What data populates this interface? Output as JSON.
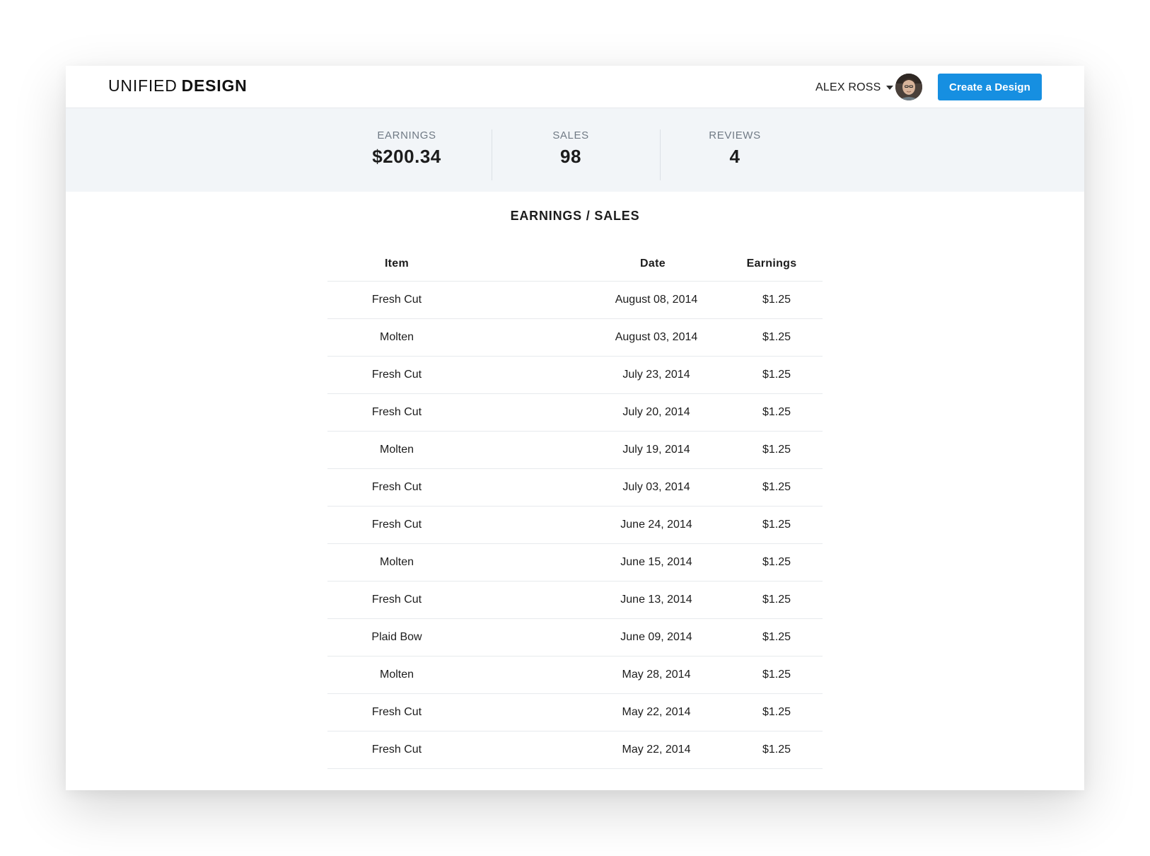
{
  "header": {
    "logo_light": "UNIFIED",
    "logo_bold": "DESIGN",
    "user_name": "ALEX ROSS",
    "create_button_label": "Create a Design"
  },
  "stats": [
    {
      "label": "EARNINGS",
      "value": "$200.34"
    },
    {
      "label": "SALES",
      "value": "98"
    },
    {
      "label": "REVIEWS",
      "value": "4"
    }
  ],
  "section_title": "EARNINGS / SALES",
  "table": {
    "columns": [
      "Item",
      "Date",
      "Earnings"
    ],
    "rows": [
      {
        "item": "Fresh Cut",
        "date": "August 08, 2014",
        "earnings": "$1.25"
      },
      {
        "item": "Molten",
        "date": "August 03, 2014",
        "earnings": "$1.25"
      },
      {
        "item": "Fresh Cut",
        "date": "July 23, 2014",
        "earnings": "$1.25"
      },
      {
        "item": "Fresh Cut",
        "date": "July 20, 2014",
        "earnings": "$1.25"
      },
      {
        "item": "Molten",
        "date": "July 19, 2014",
        "earnings": "$1.25"
      },
      {
        "item": "Fresh Cut",
        "date": "July 03, 2014",
        "earnings": "$1.25"
      },
      {
        "item": "Fresh Cut",
        "date": "June 24, 2014",
        "earnings": "$1.25"
      },
      {
        "item": "Molten",
        "date": "June 15, 2014",
        "earnings": "$1.25"
      },
      {
        "item": "Fresh Cut",
        "date": "June 13, 2014",
        "earnings": "$1.25"
      },
      {
        "item": "Plaid Bow",
        "date": "June 09, 2014",
        "earnings": "$1.25"
      },
      {
        "item": "Molten",
        "date": "May 28, 2014",
        "earnings": "$1.25"
      },
      {
        "item": "Fresh Cut",
        "date": "May 22, 2014",
        "earnings": "$1.25"
      },
      {
        "item": "Fresh Cut",
        "date": "May 22, 2014",
        "earnings": "$1.25"
      }
    ]
  },
  "colors": {
    "accent": "#168fe1",
    "stats_background": "#f2f5f8",
    "divider": "#e7eaed"
  }
}
